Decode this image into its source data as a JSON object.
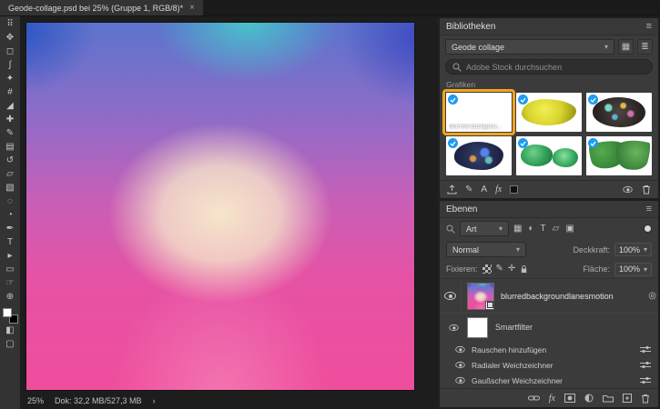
{
  "window": {
    "tab_title": "Geode-collage.psd bei 25% (Gruppe 1, RGB/8)*",
    "tab_close": "×"
  },
  "statusbar": {
    "zoom": "25%",
    "doc_info": "Dok: 32,2 MB/527,3 MB",
    "chevron": "›"
  },
  "tools": [
    {
      "name": "toolbar-grip",
      "glyph": "⠿"
    },
    {
      "name": "move-tool",
      "glyph": "✥"
    },
    {
      "name": "marquee-tool",
      "glyph": "◻"
    },
    {
      "name": "lasso-tool",
      "glyph": "ʃ"
    },
    {
      "name": "quick-selection-tool",
      "glyph": "✦"
    },
    {
      "name": "crop-tool",
      "glyph": "#"
    },
    {
      "name": "eyedropper-tool",
      "glyph": "◢"
    },
    {
      "name": "healing-brush-tool",
      "glyph": "✚"
    },
    {
      "name": "brush-tool",
      "glyph": "✎"
    },
    {
      "name": "clone-stamp-tool",
      "glyph": "▤"
    },
    {
      "name": "history-brush-tool",
      "glyph": "↺"
    },
    {
      "name": "eraser-tool",
      "glyph": "▱"
    },
    {
      "name": "gradient-tool",
      "glyph": "▧"
    },
    {
      "name": "blur-tool",
      "glyph": "◌"
    },
    {
      "name": "dodge-tool",
      "glyph": "◔"
    },
    {
      "name": "pen-tool",
      "glyph": "✒"
    },
    {
      "name": "type-tool",
      "glyph": "T"
    },
    {
      "name": "path-selection-tool",
      "glyph": "▸"
    },
    {
      "name": "shape-tool",
      "glyph": "▭"
    },
    {
      "name": "hand-tool",
      "glyph": "☞"
    },
    {
      "name": "zoom-tool",
      "glyph": "⊕"
    }
  ],
  "toolbox_extra": {
    "quick_mask": "◧",
    "screen_mode": "▢"
  },
  "libraries": {
    "panel_title": "Bibliotheken",
    "collection_select": "Geode collage",
    "search_placeholder": "Adobe Stock durchsuchen",
    "section_label": "Grafiken",
    "items": [
      {
        "label": "blurred backgrou...",
        "type": "gradient-image",
        "selected": true
      },
      {
        "type": "yellow-mineral-photo"
      },
      {
        "type": "dark-mineral-photo"
      },
      {
        "type": "blue-mineral-photo"
      },
      {
        "type": "green-mineral-photo"
      },
      {
        "type": "monstera-leaves-photo"
      }
    ]
  },
  "layers": {
    "panel_title": "Ebenen",
    "type_filter_label": "Art",
    "blend_mode": "Normal",
    "opacity_label": "Deckkraft:",
    "opacity_value": "100%",
    "lock_label": "Fixieren:",
    "fill_label": "Fläche:",
    "fill_value": "100%",
    "layer_name": "blurredbackgroundlanesmotion",
    "smart_filter_label": "Smartfilter",
    "filters": [
      "Rauschen hinzufügen",
      "Radialer Weichzeichner",
      "Gaußscher Weichzeichner"
    ]
  },
  "icons": {
    "menu": "≡",
    "chevron_down": "▾",
    "grid_view": "▦",
    "list_view": "≣",
    "brush": "✎",
    "text_style": "A",
    "fx": "fx",
    "filter_pixel": "▦",
    "filter_adjust": "◐",
    "filter_type": "T",
    "filter_shape": "▱",
    "filter_smart": "▣",
    "lock_brush": "✎",
    "lock_move": "✛",
    "smart_filter_toggle": "◎"
  },
  "colors": {
    "panel_bg": "#3B3B3B",
    "pasteboard": "#1D1D1D",
    "highlight_orange": "#F2A41F",
    "sync_badge_blue": "#1E9BF0",
    "gradient_stops": [
      "#2A52C4",
      "#48C6CB",
      "#F7E8CB",
      "#EF4E9C"
    ]
  }
}
